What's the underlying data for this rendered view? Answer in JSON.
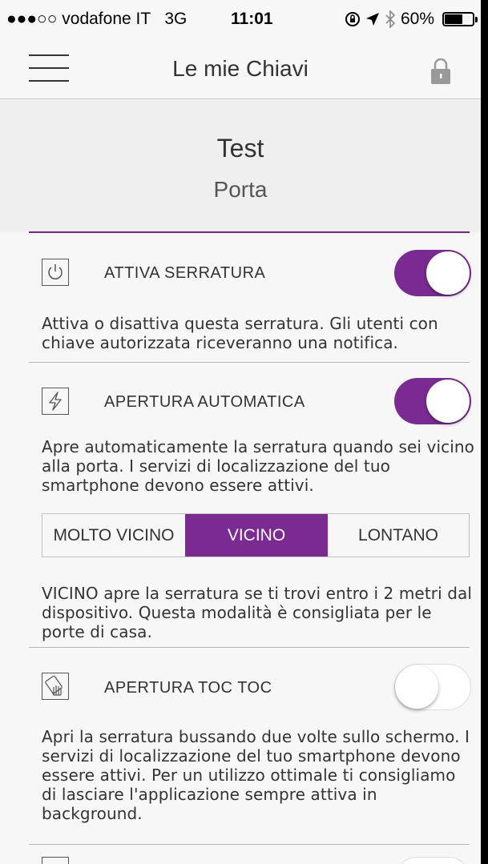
{
  "status_bar": {
    "signal": "●●●○○",
    "carrier": "vodafone IT",
    "network": "3G",
    "time": "11:01",
    "battery": "60%",
    "battery_level": 0.6
  },
  "nav": {
    "title": "Le mie Chiavi"
  },
  "header": {
    "name": "Test",
    "type": "Porta"
  },
  "settings": {
    "activate": {
      "label": "ATTIVA SERRATURA",
      "description": "Attiva o disattiva questa serratura. Gli utenti con chiave autorizzata riceveranno una notifica.",
      "enabled": true
    },
    "auto_open": {
      "label": "APERTURA AUTOMATICA",
      "description": "Apre automaticamente la serratura quando sei vicino alla porta. I servizi di localizzazione del tuo smartphone devono essere attivi.",
      "enabled": true,
      "distance_options": [
        "MOLTO VICINO",
        "VICINO",
        "LONTANO"
      ],
      "selected_distance": "VICINO",
      "distance_description": "VICINO apre la serratura se ti trovi entro i 2 metri dal dispositivo. Questa modalità è consigliata per le porte di casa."
    },
    "knock": {
      "label": "APERTURA TOC TOC",
      "description": "Apri la serratura bussando due volte sullo schermo. I servizi di localizzazione del tuo smartphone devono essere attivi. Per un utilizzo ottimale ti consigliamo di lasciare l'applicazione sempre attiva in background.",
      "enabled": false
    }
  },
  "colors": {
    "accent": "#7b2a91",
    "background": "#f7f7f7",
    "header_bg": "#efefef"
  }
}
